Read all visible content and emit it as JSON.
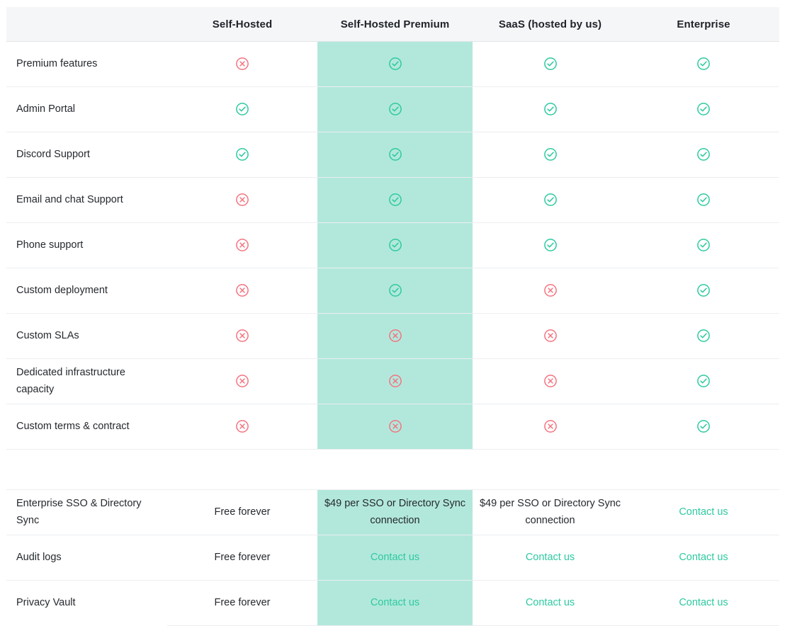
{
  "table": {
    "columns": [
      {
        "id": "feature",
        "label": "",
        "highlight": false
      },
      {
        "id": "selfhosted",
        "label": "Self-Hosted",
        "highlight": false
      },
      {
        "id": "selfhosted_premium",
        "label": "Self-Hosted Premium",
        "highlight": true
      },
      {
        "id": "saas",
        "label": "SaaS (hosted by us)",
        "highlight": false
      },
      {
        "id": "enterprise",
        "label": "Enterprise",
        "highlight": false
      }
    ],
    "feature_rows": [
      {
        "feature": "Premium features",
        "values": [
          "cross",
          "check",
          "check",
          "check"
        ]
      },
      {
        "feature": "Admin Portal",
        "values": [
          "check",
          "check",
          "check",
          "check"
        ]
      },
      {
        "feature": "Discord Support",
        "values": [
          "check",
          "check",
          "check",
          "check"
        ]
      },
      {
        "feature": "Email and chat Support",
        "values": [
          "cross",
          "check",
          "check",
          "check"
        ]
      },
      {
        "feature": "Phone support",
        "values": [
          "cross",
          "check",
          "check",
          "check"
        ]
      },
      {
        "feature": "Custom deployment",
        "values": [
          "cross",
          "check",
          "cross",
          "check"
        ]
      },
      {
        "feature": "Custom SLAs",
        "values": [
          "cross",
          "cross",
          "cross",
          "check"
        ]
      },
      {
        "feature": "Dedicated infrastructure capacity",
        "values": [
          "cross",
          "cross",
          "cross",
          "check"
        ]
      },
      {
        "feature": "Custom terms & contract",
        "values": [
          "cross",
          "cross",
          "cross",
          "check"
        ]
      }
    ],
    "pricing_rows": [
      {
        "feature": "Enterprise SSO & Directory Sync",
        "values": [
          {
            "kind": "text",
            "text": "Free forever"
          },
          {
            "kind": "text",
            "text": "$49 per SSO or Directory Sync connection"
          },
          {
            "kind": "text",
            "text": "$49 per SSO or Directory Sync connection"
          },
          {
            "kind": "link",
            "text": "Contact us"
          }
        ]
      },
      {
        "feature": "Audit logs",
        "values": [
          {
            "kind": "text",
            "text": "Free forever"
          },
          {
            "kind": "link",
            "text": "Contact us"
          },
          {
            "kind": "link",
            "text": "Contact us"
          },
          {
            "kind": "link",
            "text": "Contact us"
          }
        ]
      },
      {
        "feature": "Privacy Vault",
        "values": [
          {
            "kind": "text",
            "text": "Free forever"
          },
          {
            "kind": "link",
            "text": "Contact us"
          },
          {
            "kind": "link",
            "text": "Contact us"
          },
          {
            "kind": "link",
            "text": "Contact us"
          }
        ]
      }
    ],
    "icons": {
      "check": "check-circle-icon",
      "cross": "cross-circle-icon"
    },
    "colors": {
      "check": "#2ec9a0",
      "cross": "#f4737f",
      "highlight_background": "#b2e8dc",
      "header_background": "#f5f6f7",
      "link": "#2ec9a0",
      "row_border": "#eceef0",
      "text": "#25292e"
    }
  }
}
